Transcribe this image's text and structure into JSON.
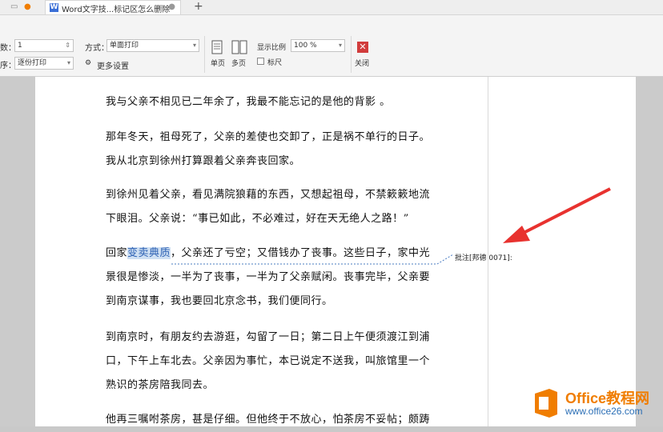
{
  "tabs": {
    "active_title": "Word文字技...标记区怎么删除",
    "new_tab": "+",
    "w_letter": "W"
  },
  "toolbar": {
    "copies_label": "数：",
    "copies_value": "1",
    "order_label": "序：",
    "order_value": "逐份打印",
    "mode_label": "方式：",
    "mode_value": "单面打印",
    "more_settings": "更多设置",
    "single_page": "单页",
    "multi_page": "多页",
    "zoom_label": "显示比例",
    "zoom_value": "100 %",
    "ruler_label": "标尺",
    "close_label": "关闭",
    "close_glyph": "✕"
  },
  "document": {
    "p1": "我与父亲不相见已二年余了，我最不能忘记的是他的背影 。",
    "p2": "那年冬天，祖母死了，父亲的差使也交卸了，正是祸不单行的日子。我从北京到徐州打算跟着父亲奔丧回家。",
    "p3": "到徐州见着父亲，看见满院狼藉的东西，又想起祖母，不禁簌簌地流下眼泪。父亲说：“事已如此，不必难过，好在天无绝人之路！”",
    "p4_before": "回家",
    "p4_highlight": "变卖典质",
    "p4_after": "，父亲还了亏空；又借钱办了丧事。这些日子，家中光景很是惨淡，一半为了丧事，一半为了父亲赋闲。丧事完毕，父亲要到南京谋事，我也要回北京念书，我们便同行。",
    "p5": "到南京时，有朋友约去游逛，勾留了一日；第二日上午便须渡江到浦口，下午上车北去。父亲因为事忙，本已说定不送我，叫旅馆里一个熟识的茶房陪我同去。",
    "p6": "他再三嘱咐茶房，甚是仔细。但他终于不放心，怕茶房不妥帖；颇踌"
  },
  "comment": {
    "text": "批注[邦德 0071]:"
  },
  "watermark": {
    "brand": "Office教程网",
    "url": "www.office26.com"
  },
  "colors": {
    "arrow": "#e8322f",
    "logo_orange": "#f07d00",
    "highlight": "#cfe0f3",
    "close_red": "#d13c3c"
  }
}
